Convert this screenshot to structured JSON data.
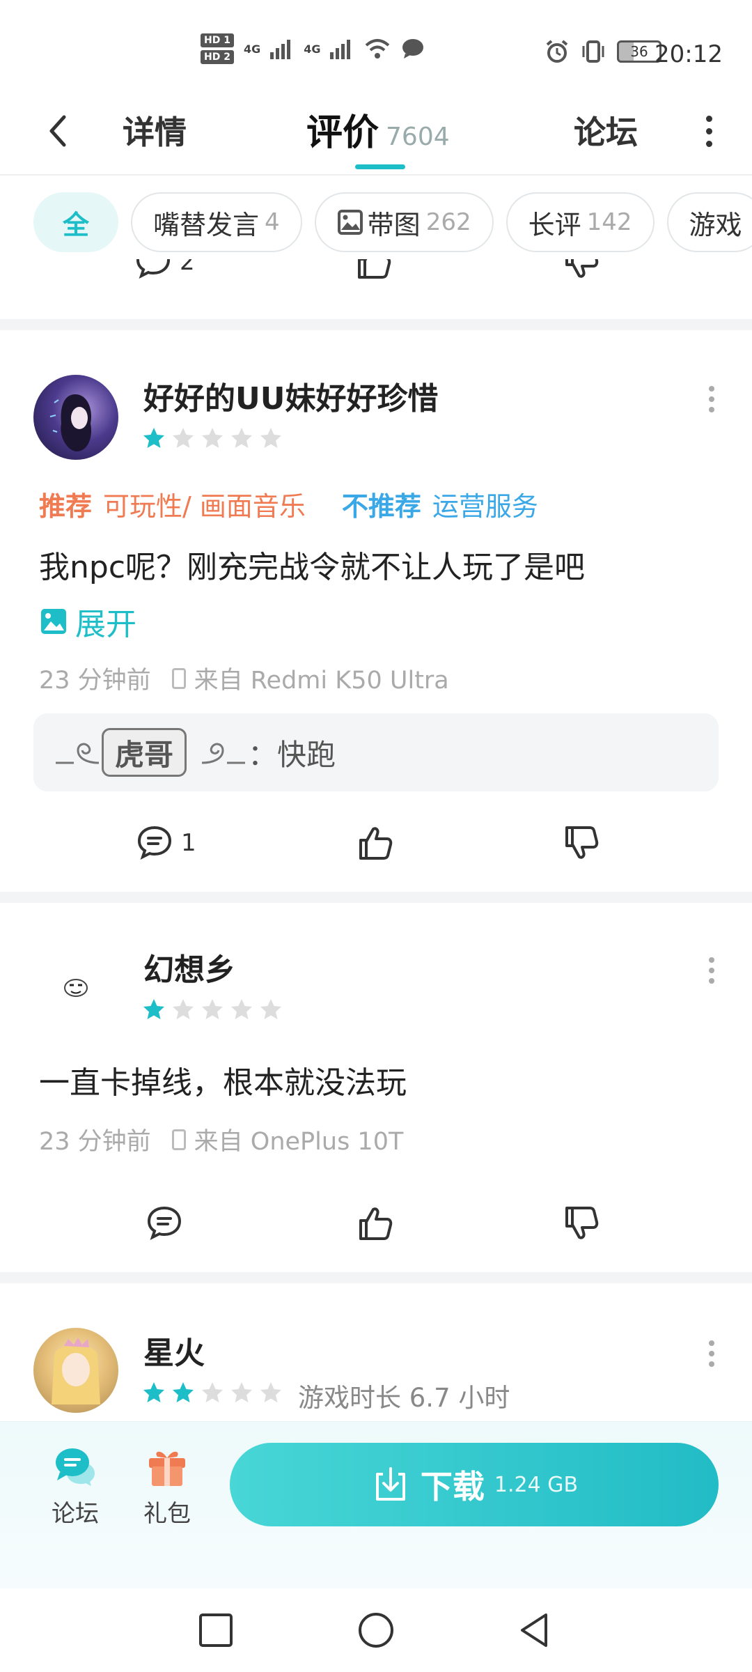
{
  "status_bar": {
    "time": "20:12",
    "hd1": "HD 1",
    "hd2": "HD 2",
    "network1": "4G",
    "network2": "4G",
    "battery": "36"
  },
  "header": {
    "tab_details": "详情",
    "tab_reviews": "评价",
    "tab_reviews_count": "7604",
    "tab_forum": "论坛"
  },
  "filters": [
    {
      "label": "全",
      "count": ""
    },
    {
      "label": "嘴替发言",
      "count": "4"
    },
    {
      "label": "带图",
      "count": "262"
    },
    {
      "label": "长评",
      "count": "142"
    },
    {
      "label": "游戏",
      "count": ""
    }
  ],
  "prev_review": {
    "comment_count": "2"
  },
  "reviews": [
    {
      "username": "好好的UU妹好好珍惜",
      "rating": 1,
      "recommend_label": "推荐",
      "recommend_items": "可玩性/ 画面音乐",
      "not_recommend_label": "不推荐",
      "not_recommend_items": "运营服务",
      "text": "我npc呢？刚充完战令就不让人玩了是吧",
      "expand": "展开",
      "time": "23 分钟前",
      "device": "来自 Redmi K50 Ultra",
      "reply_badge": "虎哥",
      "reply_text": "：快跑",
      "comment_count": "1"
    },
    {
      "username": "幻想乡",
      "rating": 1,
      "text": "一直卡掉线，根本就没法玩",
      "time": "23 分钟前",
      "device": "来自 OnePlus 10T",
      "comment_count": ""
    },
    {
      "username": "星火",
      "rating": 2,
      "playtime": "游戏时长 6.7 小时"
    }
  ],
  "bottom_bar": {
    "forum": "论坛",
    "gift": "礼包",
    "download": "下载",
    "download_size": "1.24 GB"
  },
  "colors": {
    "accent": "#1dbec7",
    "recommend": "#f07b52",
    "not_recommend": "#3aa7e6",
    "star_filled": "#1dbec7",
    "star_empty": "#dddddd"
  }
}
